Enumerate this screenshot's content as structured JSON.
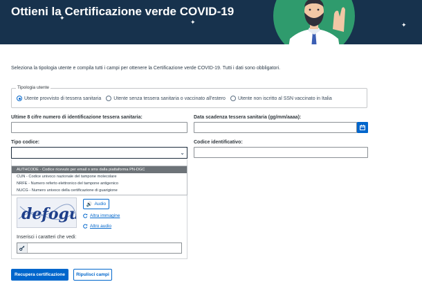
{
  "header": {
    "title": "Ottieni la Certificazione verde COVID-19"
  },
  "intro": "Seleziona la tipologia utente e compila tutti i campi per ottenere la Certificazione verde COVID-19. Tutti i dati sono obbligatori.",
  "user_type": {
    "legend": "Tipologia utente",
    "options": [
      "Utente provvisto di tessera sanitaria",
      "Utente senza tessera sanitaria o vaccinato all'estero",
      "Utente non iscritto al SSN vaccinato in Italia"
    ],
    "selected_index": 0
  },
  "fields": {
    "card_number_label": "Ultime 8 cifre numero di identificazione tessera sanitaria:",
    "card_expiry_label": "Data scadenza tessera sanitaria (gg/mm/aaaa):",
    "code_type_label": "Tipo codice:",
    "identifier_label": "Codice identificativo:"
  },
  "code_type_options": [
    "AUTHCODE - Codice ricevuto per email o sms dalla piattaforma PN-DGC",
    "CUN - Codice univoco nazionale del tampone molecolare",
    "NRFE - Numero referto elettronico del tampone antigenico",
    "NUCG - Numero univoco della certificazione di guarigione"
  ],
  "captcha": {
    "text": "defogure",
    "audio_label": "Audio",
    "other_image_label": "Altra immagine",
    "other_audio_label": "Altro audio",
    "input_label": "Inserisci i caratteri che vedi:"
  },
  "buttons": {
    "submit": "Recupera certificazione",
    "reset": "Ripulisci campi"
  },
  "colors": {
    "header_bg": "#17324d",
    "primary": "#0066cc",
    "avatar_bg": "#2f9b6d"
  }
}
